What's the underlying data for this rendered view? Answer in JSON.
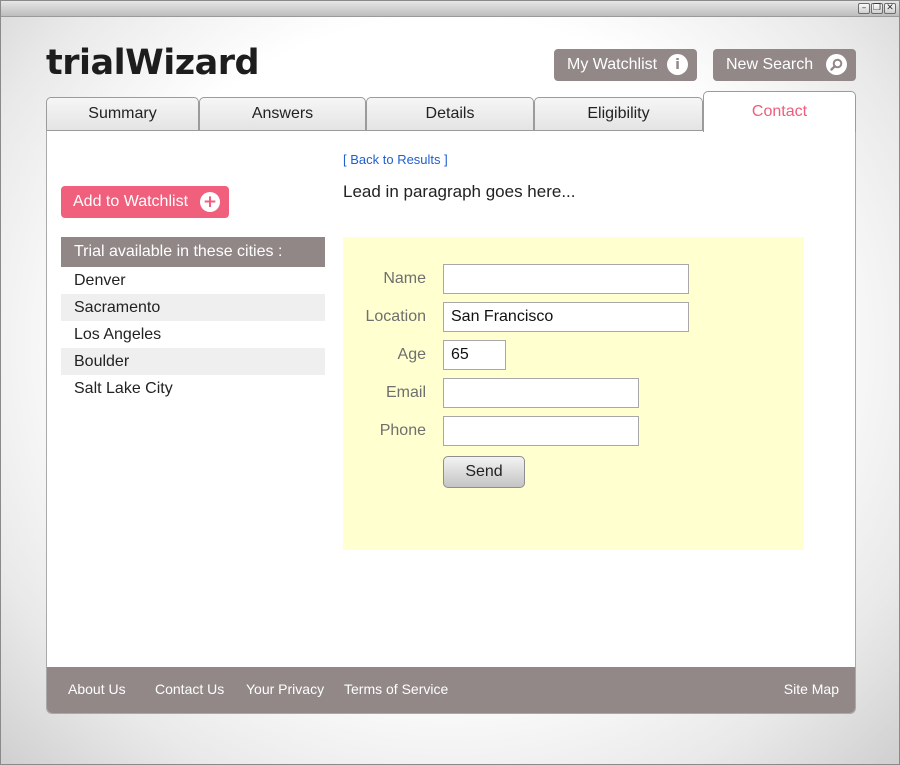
{
  "window": {
    "controls": [
      "minimize",
      "restore",
      "close"
    ]
  },
  "header": {
    "logo": "trialWizard",
    "watchlist_label": "My Watchlist",
    "watchlist_icon": "info-icon",
    "new_search_label": "New Search",
    "new_search_icon": "search-icon"
  },
  "tabs": [
    {
      "label": "Summary",
      "active": false
    },
    {
      "label": "Answers",
      "active": false
    },
    {
      "label": "Details",
      "active": false
    },
    {
      "label": "Eligibility",
      "active": false
    },
    {
      "label": "Contact",
      "active": true
    }
  ],
  "sidebar": {
    "add_label": "Add to Watchlist",
    "add_icon": "plus-circle-icon",
    "cities_heading": "Trial available in these cities :",
    "cities": [
      "Denver",
      "Sacramento",
      "Los Angeles",
      "Boulder",
      "Salt Lake City"
    ]
  },
  "main": {
    "back_link": "[ Back to Results ]",
    "lead": "Lead in paragraph goes here...",
    "form": {
      "name_label": "Name",
      "name_value": "",
      "location_label": "Location",
      "location_value": "San Francisco",
      "age_label": "Age",
      "age_value": "65",
      "email_label": "Email",
      "email_value": "",
      "phone_label": "Phone",
      "phone_value": "",
      "send_label": "Send"
    }
  },
  "footer": {
    "links": [
      "About Us",
      "Contact Us",
      "Your Privacy",
      "Terms of Service"
    ],
    "site_map": "Site Map"
  },
  "colors": {
    "accent_pink": "#ef5d7a",
    "header_button_gray": "#928888",
    "form_background": "#ffffcf",
    "link_blue": "#1f5fd0"
  }
}
